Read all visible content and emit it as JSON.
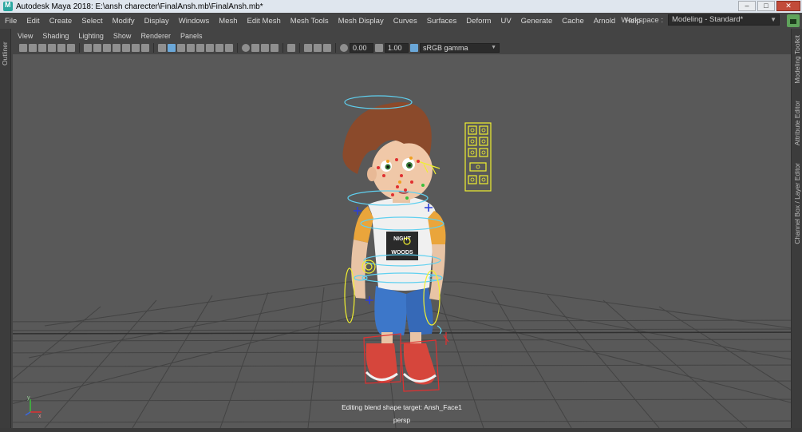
{
  "window": {
    "title": "Autodesk Maya 2018: E:\\ansh charecter\\FinalAnsh.mb\\FinalAnsh.mb*",
    "minimize": "–",
    "maximize": "□",
    "close": "✕"
  },
  "menu": [
    "File",
    "Edit",
    "Create",
    "Select",
    "Modify",
    "Display",
    "Windows",
    "Mesh",
    "Edit Mesh",
    "Mesh Tools",
    "Mesh Display",
    "Curves",
    "Surfaces",
    "Deform",
    "UV",
    "Generate",
    "Cache",
    "Arnold",
    "Help"
  ],
  "workspace": {
    "label": "Workspace :",
    "value": "Modeling - Standard*"
  },
  "left_panel": {
    "outliner_tab": "Outliner"
  },
  "right_panel": {
    "tabs": [
      "Modeling Toolkit",
      "Attribute Editor",
      "Channel Box / Layer Editor"
    ]
  },
  "panel_menu": [
    "View",
    "Shading",
    "Lighting",
    "Show",
    "Renderer",
    "Panels"
  ],
  "toolbar": {
    "exposure": "0.00",
    "gamma": "1.00",
    "color_space": "sRGB gamma"
  },
  "viewport": {
    "message": "Editing blend shape target: Ansh_Face1",
    "camera": "persp",
    "shirt_text": [
      "NIGHT",
      "WOODS"
    ],
    "axis_labels": [
      "y",
      "x"
    ],
    "grid_color": "#3f3f3f",
    "control_colors": {
      "nurbs": "#5fd0f0",
      "selected": "#f0f030",
      "ik": "#e03030",
      "locator": "#2b3fd8"
    }
  }
}
